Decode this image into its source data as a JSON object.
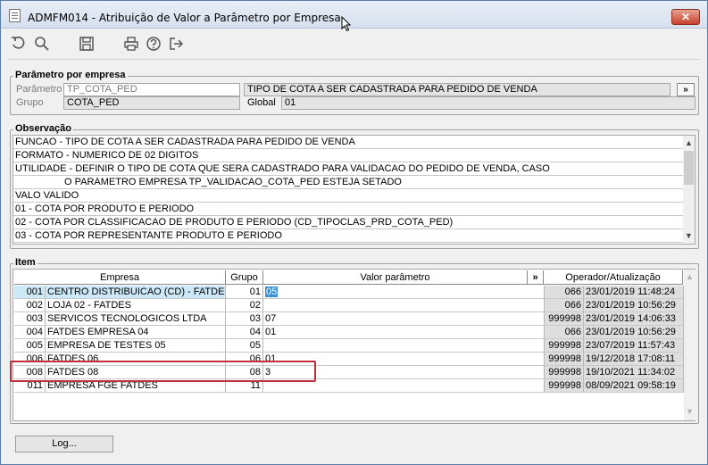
{
  "window": {
    "title": "ADMFM014 - Atribuição de Valor a Parâmetro por Empresa",
    "close_label": "✕"
  },
  "toolbar": {
    "icons": [
      "undo-icon",
      "search-icon",
      "save-icon",
      "print-icon",
      "help-icon",
      "exit-icon"
    ]
  },
  "parametro_group": {
    "title": "Parâmetro por empresa",
    "parametro_label": "Parâmetro",
    "parametro_value": "TP_COTA_PED",
    "parametro_desc": "TIPO DE COTA A SER CADASTRADA PARA PEDIDO DE VENDA",
    "more_button": "»",
    "grupo_label": "Grupo",
    "grupo_value": "COTA_PED",
    "global_label": "Global",
    "global_value": "01"
  },
  "observacao": {
    "title": "Observação",
    "lines": [
      "FUNCAO - TIPO DE COTA A SER CADASTRADA PARA PEDIDO DE VENDA",
      "FORMATO - NUMERICO DE 02 DIGITOS",
      "UTILIDADE - DEFINIR O TIPO DE COTA QUE SERA CADASTRADO PARA VALIDACAO DO PEDIDO DE VENDA, CASO",
      "                  O PARAMETRO EMPRESA TP_VALIDACAO_COTA_PED ESTEJA SETADO",
      "VALO VALIDO",
      "01 - COTA POR PRODUTO E PERIODO",
      "02 - COTA POR CLASSIFICACAO DE PRODUTO E PERIODO (CD_TIPOCLAS_PRD_COTA_PED)",
      "03 - COTA POR REPRESENTANTE PRODUTO E PERIODO"
    ]
  },
  "item": {
    "title": "Item",
    "headers": {
      "empresa": "Empresa",
      "grupo": "Grupo",
      "valor": "Valor parâmetro",
      "more": "»",
      "operador": "Operador/Atualização"
    },
    "rows": [
      {
        "cod": "001",
        "empresa": "CENTRO DISTRIBUICAO (CD) - FATDES",
        "grupo": "01",
        "valor": "05",
        "operador": "066",
        "data": "23/01/2019 11:48:24",
        "selected": true
      },
      {
        "cod": "002",
        "empresa": "LOJA 02 - FATDES",
        "grupo": "02",
        "valor": "",
        "operador": "066",
        "data": "23/01/2019 10:56:29"
      },
      {
        "cod": "003",
        "empresa": "SERVICOS TECNOLOGICOS LTDA",
        "grupo": "03",
        "valor": "07",
        "operador": "999998",
        "data": "23/01/2019 14:06:33"
      },
      {
        "cod": "004",
        "empresa": "FATDES EMPRESA 04",
        "grupo": "04",
        "valor": "01",
        "operador": "066",
        "data": "23/01/2019 10:56:29"
      },
      {
        "cod": "005",
        "empresa": "EMPRESA DE TESTES 05",
        "grupo": "05",
        "valor": "",
        "operador": "999998",
        "data": "23/07/2019 11:57:43"
      },
      {
        "cod": "006",
        "empresa": "FATDES 06",
        "grupo": "06",
        "valor": "01",
        "operador": "999998",
        "data": "19/12/2018 17:08:11"
      },
      {
        "cod": "008",
        "empresa": "FATDES 08",
        "grupo": "08",
        "valor": "3",
        "operador": "999998",
        "data": "19/10/2021 11:34:02"
      },
      {
        "cod": "011",
        "empresa": "EMPRESA FGE FATDES",
        "grupo": "11",
        "valor": "",
        "operador": "999998",
        "data": "08/09/2021 09:58:19"
      }
    ]
  },
  "footer": {
    "log_button": "Log..."
  }
}
